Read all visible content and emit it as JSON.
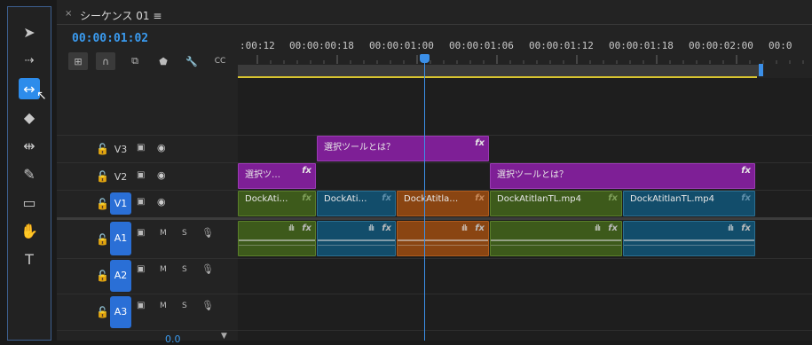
{
  "tabs": {
    "close_glyph": "×",
    "title": "シーケンス 01",
    "menu_glyph": "≡"
  },
  "timecode": "00:00:01:02",
  "ruler_labels": [
    ":00:12",
    "00:00:00:18",
    "00:00:01:00",
    "00:00:01:06",
    "00:00:01:12",
    "00:00:01:18",
    "00:00:02:00",
    "00:0"
  ],
  "tools": [
    "selection-tool",
    "track-select-tool",
    "ripple-edit-tool",
    "razor-tool",
    "slip-tool",
    "pen-tool",
    "rectangle-tool",
    "hand-tool",
    "type-tool"
  ],
  "tracks": {
    "video": [
      {
        "name": "V3"
      },
      {
        "name": "V2"
      },
      {
        "name": "V1"
      }
    ],
    "audio": [
      {
        "name": "A1",
        "m": "M",
        "s": "S"
      },
      {
        "name": "A2",
        "m": "M",
        "s": "S"
      },
      {
        "name": "A3",
        "m": "M",
        "s": "S"
      }
    ]
  },
  "clips": {
    "v3_title": "選択ツールとは？",
    "v2_title_a": "選択ツ…",
    "v2_title_b": "選択ツールとは？",
    "v1_a": "DockAti…",
    "v1_b": "DockAti…",
    "v1_c": "DockAtitla…",
    "v1_d": "DockAtitlanTL.mp4",
    "v1_e": "DockAtitlanTL.mp4",
    "fx": "fx"
  },
  "bottom_value": "0.0",
  "colors": {
    "accent": "#2d8ceb",
    "purple_clip": "#7e1f96",
    "green_clip": "#3d5a1b",
    "blue_clip": "#124d6b",
    "orange_clip": "#8a4512",
    "playhead": "#3b8fe8",
    "work_area": "#d9c530"
  }
}
